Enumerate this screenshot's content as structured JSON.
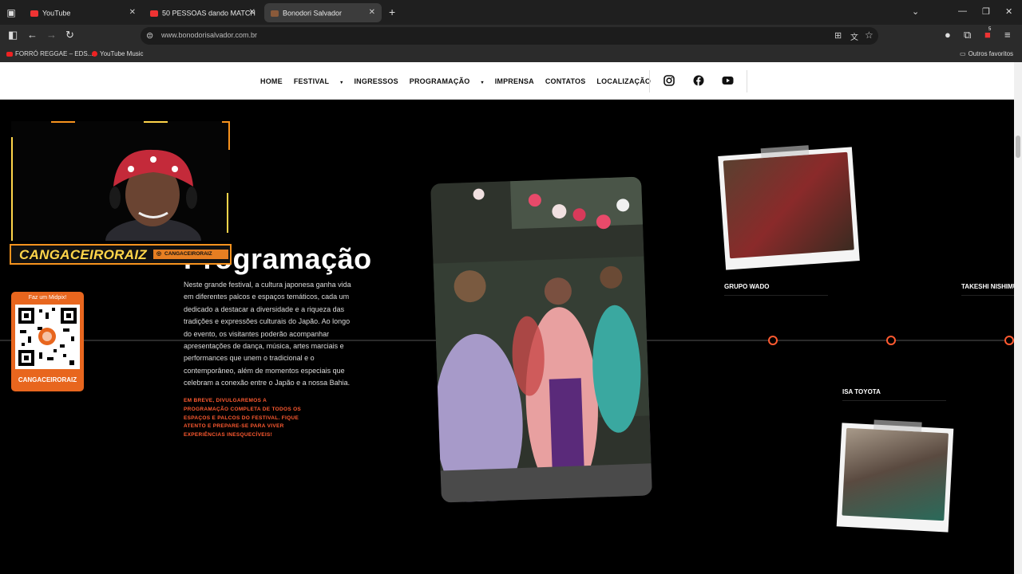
{
  "browser": {
    "tabs": [
      {
        "label": "YouTube",
        "active": false
      },
      {
        "label": "50 PESSOAS dando MATCH",
        "active": false
      },
      {
        "label": "Bonodori Salvador",
        "active": true
      }
    ],
    "url_domain": "www.bonodorisalvador.com.br",
    "bookmarks": [
      "FORRÓ REGGAE – EDS...",
      "YouTube Music"
    ],
    "other_bookmarks": "Outros favoritos",
    "extension_badge": "5"
  },
  "site": {
    "menu": {
      "home": "HOME",
      "festival": "FESTIVAL",
      "ingressos": "INGRESSOS",
      "programacao": "PROGRAMAÇÃO",
      "imprensa": "IMPRENSA",
      "contatos": "CONTATOS",
      "localizacao": "LOCALIZAÇÃO"
    },
    "social": [
      "instagram-icon",
      "facebook-icon",
      "youtube-icon"
    ]
  },
  "main": {
    "heading": "Programação",
    "description": "Neste grande festival, a cultura japonesa ganha vida em diferentes palcos e espaços temáticos, cada um dedicado a destacar a diversidade e a riqueza das tradições e expressões culturais do Japão. Ao longo do evento, os visitantes poderão acompanhar apresentações de dança, música, artes marciais e performances que unem o tradicional e o contemporâneo, além de momentos especiais que celebram a conexão entre o Japão e a nossa Bahia.",
    "notice": "EM BREVE, DIVULGAREMOS A PROGRAMAÇÃO COMPLETA DE TODOS OS ESPAÇOS E PALCOS DO FESTIVAL. FIQUE ATENTO E PREPARE-SE PARA VIVER EXPERIÊNCIAS INESQUECÍVEIS!"
  },
  "artists": {
    "grupo_wado": "GRUPO WADO",
    "takeshi": "TAKESHI NISHIMU",
    "isa_toyota": "ISA TOYOTA"
  },
  "overlay": {
    "streamer_name": "CANGACEIRORAIZ",
    "handle": "CANGACEIRORAIZ",
    "qr_title": "Faz um Midpix!",
    "qr_name": "CANGACEIRORAIZ"
  },
  "colors": {
    "accent": "#ff5a30",
    "overlay_orange": "#f7931e"
  }
}
